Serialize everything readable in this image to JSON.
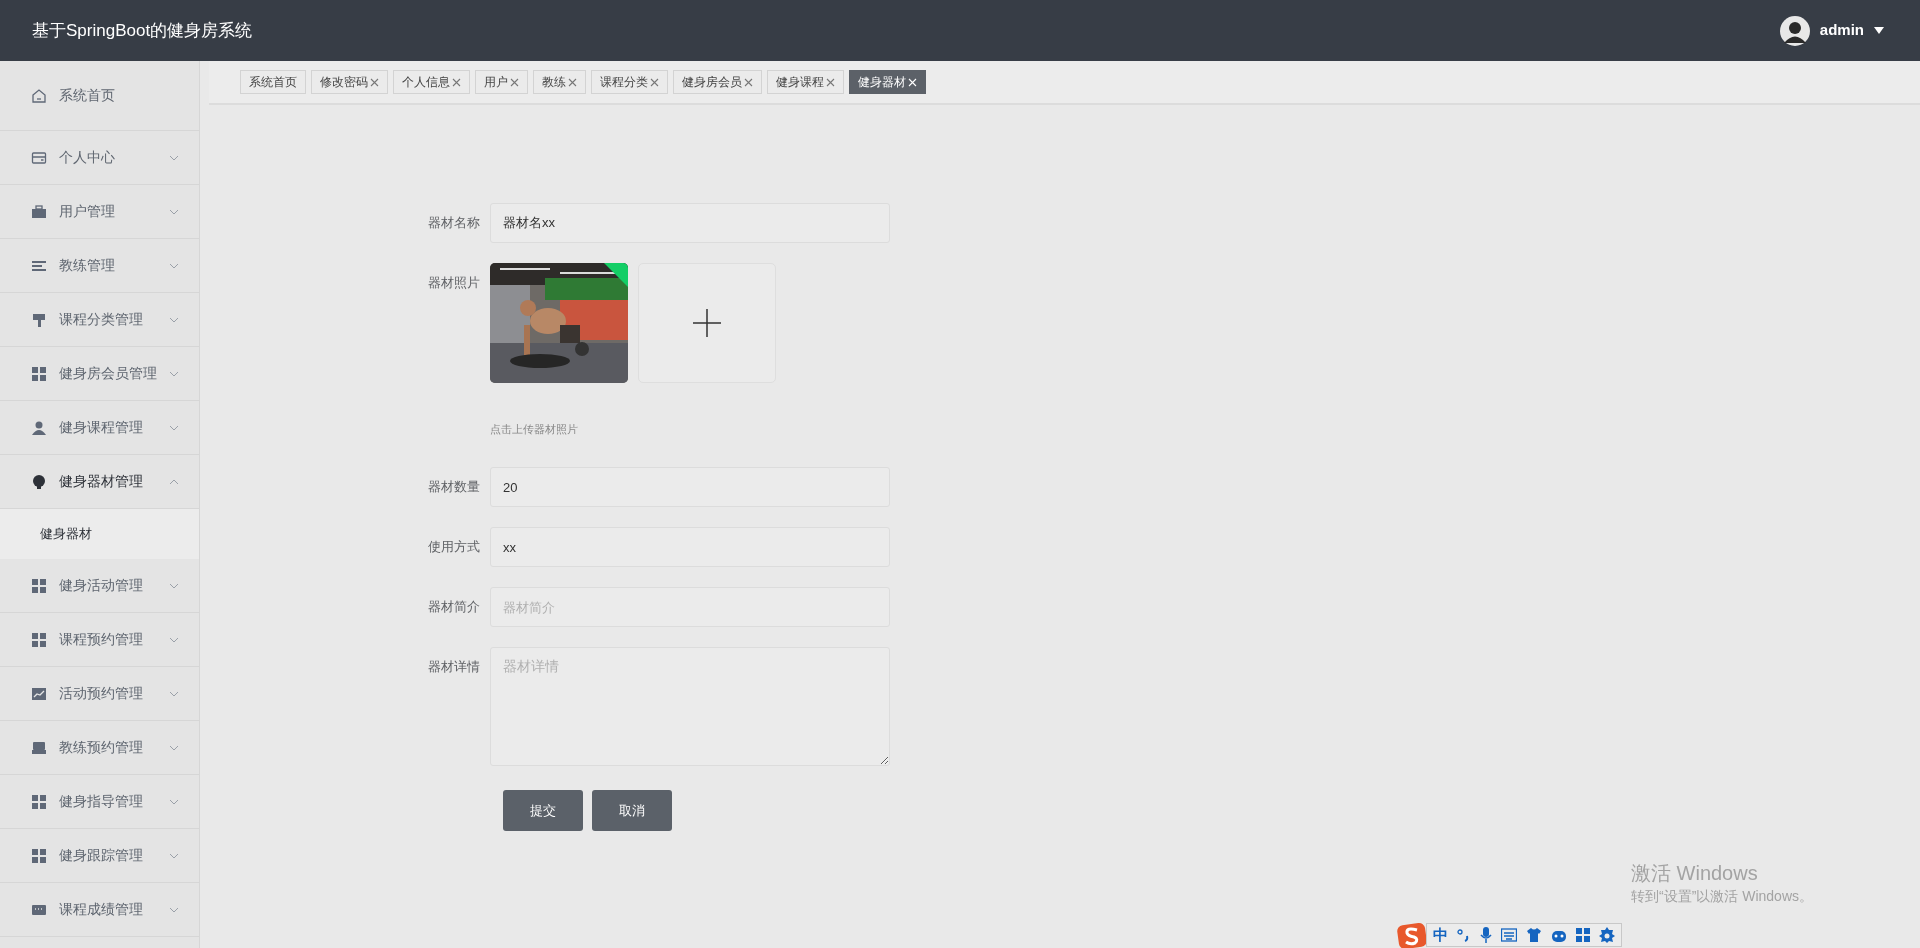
{
  "header": {
    "title": "基于SpringBoot的健身房系统",
    "user": {
      "name": "admin"
    }
  },
  "sidebar": {
    "items": [
      {
        "label": "系统首页",
        "kind": "link"
      },
      {
        "label": "个人中心",
        "kind": "menu",
        "expanded": false
      },
      {
        "label": "用户管理",
        "kind": "menu",
        "expanded": false
      },
      {
        "label": "教练管理",
        "kind": "menu",
        "expanded": false
      },
      {
        "label": "课程分类管理",
        "kind": "menu",
        "expanded": false
      },
      {
        "label": "健身房会员管理",
        "kind": "menu",
        "expanded": false
      },
      {
        "label": "健身课程管理",
        "kind": "menu",
        "expanded": false
      },
      {
        "label": "健身器材管理",
        "kind": "menu",
        "expanded": true,
        "children": [
          {
            "label": "健身器材",
            "selected": true
          }
        ]
      },
      {
        "label": "健身活动管理",
        "kind": "menu",
        "expanded": false
      },
      {
        "label": "课程预约管理",
        "kind": "menu",
        "expanded": false
      },
      {
        "label": "活动预约管理",
        "kind": "menu",
        "expanded": false
      },
      {
        "label": "教练预约管理",
        "kind": "menu",
        "expanded": false
      },
      {
        "label": "健身指导管理",
        "kind": "menu",
        "expanded": false
      },
      {
        "label": "健身跟踪管理",
        "kind": "menu",
        "expanded": false
      },
      {
        "label": "课程成绩管理",
        "kind": "menu",
        "expanded": false
      }
    ]
  },
  "tabs": [
    {
      "label": "系统首页",
      "closable": false,
      "selected": false
    },
    {
      "label": "修改密码",
      "closable": true,
      "selected": false
    },
    {
      "label": "个人信息",
      "closable": true,
      "selected": false
    },
    {
      "label": "用户",
      "closable": true,
      "selected": false
    },
    {
      "label": "教练",
      "closable": true,
      "selected": false
    },
    {
      "label": "课程分类",
      "closable": true,
      "selected": false
    },
    {
      "label": "健身房会员",
      "closable": true,
      "selected": false
    },
    {
      "label": "健身课程",
      "closable": true,
      "selected": false
    },
    {
      "label": "健身器材",
      "closable": true,
      "selected": true
    }
  ],
  "form": {
    "fields": [
      {
        "kind": "input",
        "label": "器材名称",
        "value": "器材名xx"
      },
      {
        "kind": "upload",
        "label": "器材照片",
        "hint": "点击上传器材照片",
        "photos": [
          {
            "kind": "picture",
            "uploaded": true
          }
        ]
      },
      {
        "kind": "input",
        "label": "器材数量",
        "value": "20"
      },
      {
        "kind": "input",
        "label": "使用方式",
        "value": "xx"
      },
      {
        "kind": "input",
        "label": "器材简介",
        "placeholder": "器材简介"
      },
      {
        "kind": "textarea",
        "label": "器材详情",
        "placeholder": "器材详情"
      }
    ],
    "buttons": [
      "提交",
      "取消"
    ]
  },
  "os_notice": {
    "title": "激活 Windows",
    "text": "转到“设置”以激活 Windows。"
  },
  "ime_toolbar": {
    "mode": "中"
  }
}
